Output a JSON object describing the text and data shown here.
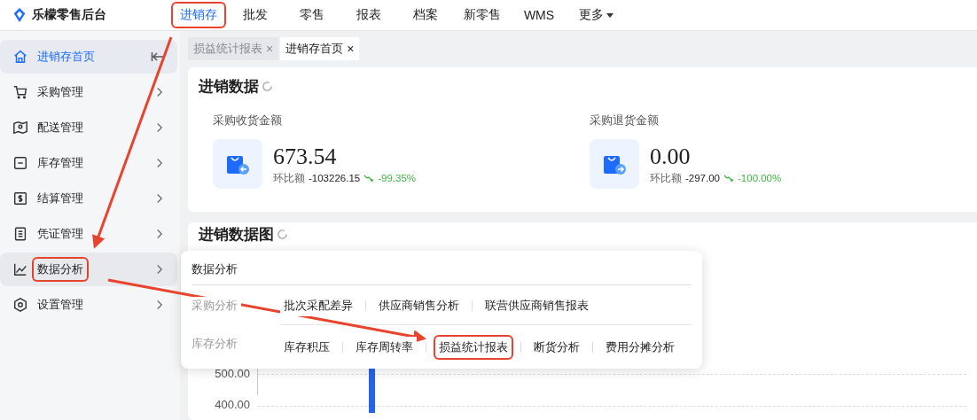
{
  "app": {
    "title": "乐檬零售后台"
  },
  "nav": [
    {
      "label": "进销存",
      "selected": true,
      "annotated": true
    },
    {
      "label": "批发",
      "selected": false,
      "annotated": false
    },
    {
      "label": "零售",
      "selected": false,
      "annotated": false
    },
    {
      "label": "报表",
      "selected": false,
      "annotated": false
    },
    {
      "label": "档案",
      "selected": false,
      "annotated": false
    },
    {
      "label": "新零售",
      "selected": false,
      "annotated": false
    },
    {
      "label": "WMS",
      "selected": false,
      "annotated": false
    },
    {
      "label": "更多",
      "selected": false,
      "annotated": false,
      "dropdown": true
    }
  ],
  "sidebar": {
    "items": [
      {
        "label": "进销存首页",
        "selected": true,
        "hovered": false,
        "annotated": false
      },
      {
        "label": "采购管理",
        "selected": false,
        "hovered": false,
        "annotated": false
      },
      {
        "label": "配送管理",
        "selected": false,
        "hovered": false,
        "annotated": false
      },
      {
        "label": "库存管理",
        "selected": false,
        "hovered": false,
        "annotated": false
      },
      {
        "label": "结算管理",
        "selected": false,
        "hovered": false,
        "annotated": false
      },
      {
        "label": "凭证管理",
        "selected": false,
        "hovered": false,
        "annotated": false
      },
      {
        "label": "数据分析",
        "selected": false,
        "hovered": true,
        "annotated": true
      },
      {
        "label": "设置管理",
        "selected": false,
        "hovered": false,
        "annotated": false
      }
    ]
  },
  "tabs": [
    {
      "label": "损益统计报表",
      "selected": false,
      "close": "×"
    },
    {
      "label": "进销存首页",
      "selected": true,
      "close": "×"
    }
  ],
  "summary": {
    "title": "进销数据",
    "stats": [
      {
        "label": "采购收货金额",
        "value": "673.54",
        "compare_label": "环比额",
        "delta": "-103226.15",
        "percent": "-99.35%",
        "falling": true
      },
      {
        "label": "采购退货金额",
        "value": "0.00",
        "compare_label": "环比额",
        "delta": "-297.00",
        "percent": "-100.00%",
        "falling": true
      }
    ]
  },
  "chart_card": {
    "title": "进销数据图",
    "y_labels": [
      "500.00",
      "400.00"
    ]
  },
  "flyout": {
    "title": "数据分析",
    "groups": [
      {
        "label": "采购分析",
        "items": [
          {
            "label": "批次采配差异",
            "annotated": false
          },
          {
            "label": "供应商销售分析",
            "annotated": false
          },
          {
            "label": "联营供应商销售报表",
            "annotated": false
          }
        ]
      },
      {
        "label": "库存分析",
        "items": [
          {
            "label": "库存积压",
            "annotated": false
          },
          {
            "label": "库存周转率",
            "annotated": false
          },
          {
            "label": "损益统计报表",
            "annotated": true
          },
          {
            "label": "断货分析",
            "annotated": false
          },
          {
            "label": "费用分摊分析",
            "annotated": false
          }
        ]
      }
    ]
  }
}
